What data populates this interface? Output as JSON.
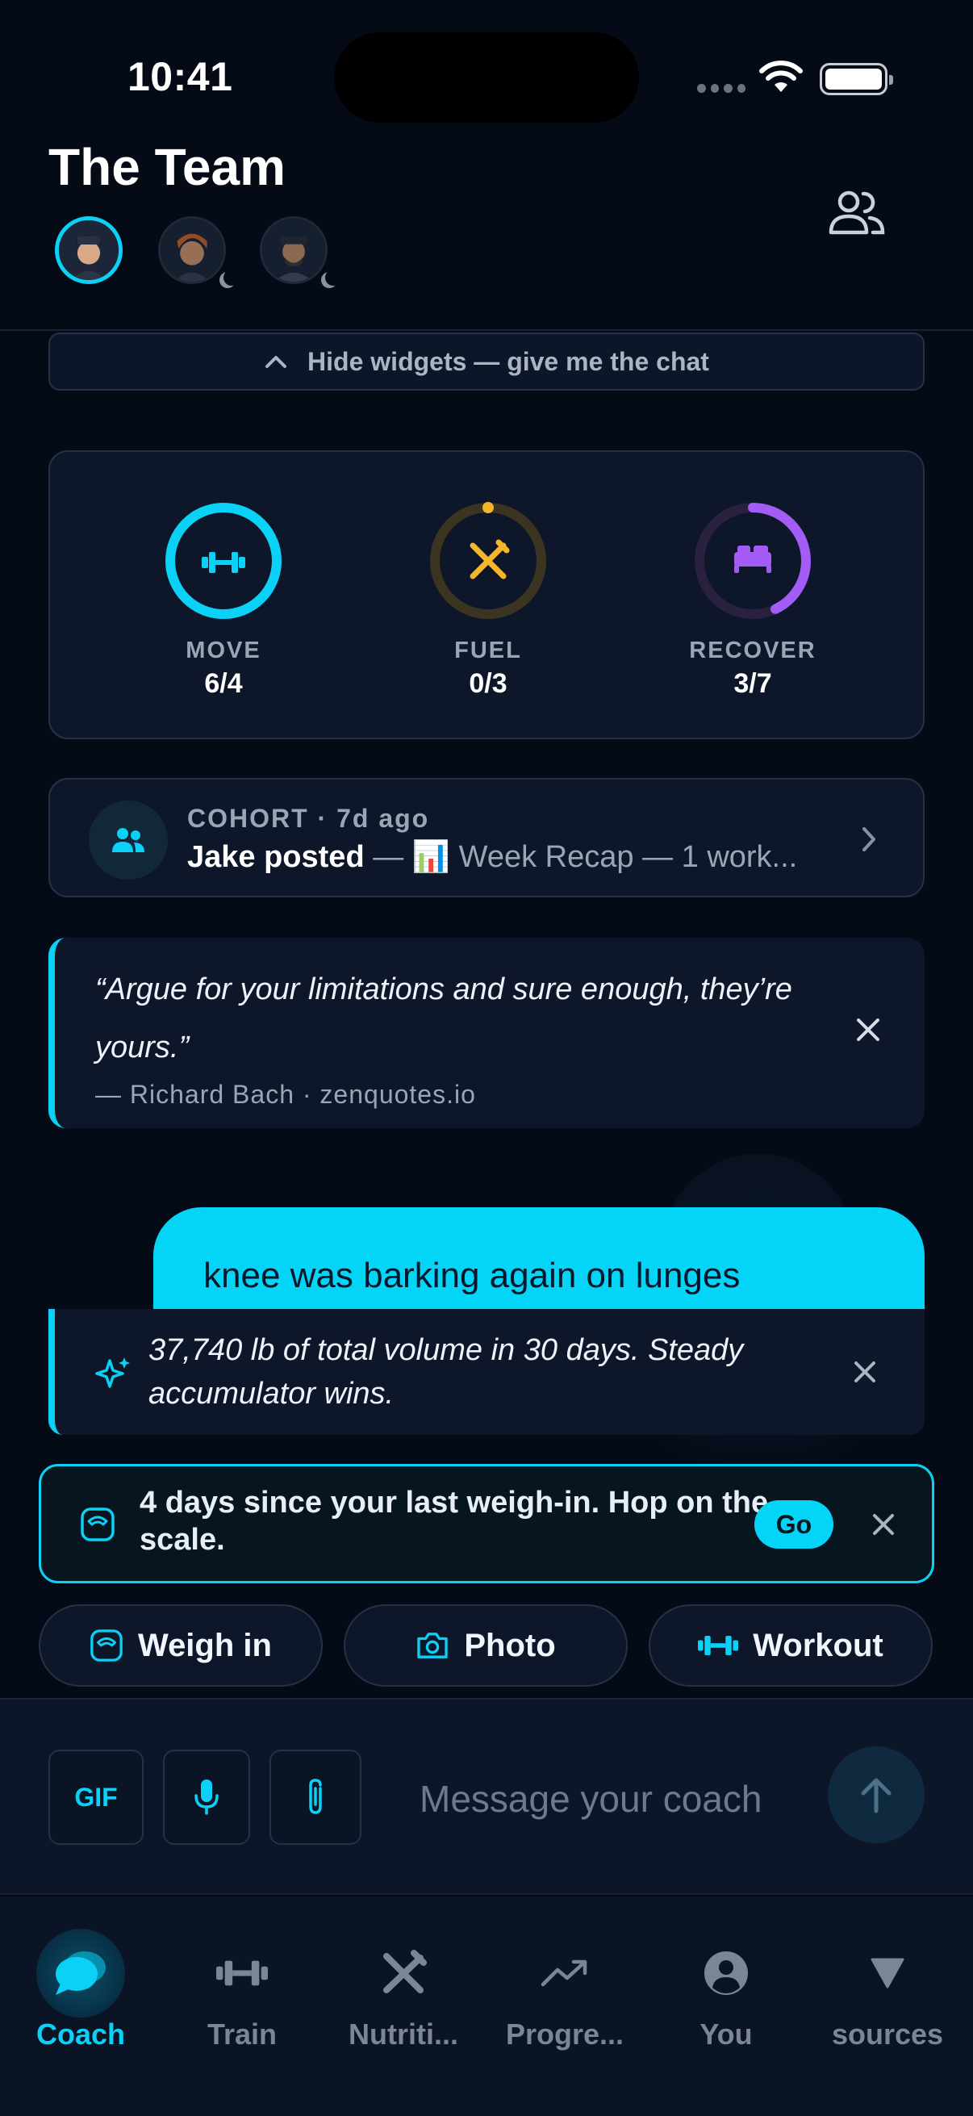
{
  "status_bar": {
    "time": "10:41"
  },
  "header": {
    "title": "The Team"
  },
  "widgets_toggle": {
    "label": "Hide widgets — give me the chat"
  },
  "rings": [
    {
      "label": "MOVE",
      "value": "6/4",
      "progress": 1.0,
      "color": "#0ad1f5",
      "icon": "dumbbell-icon"
    },
    {
      "label": "FUEL",
      "value": "0/3",
      "progress": 0.0,
      "color": "#f5b62a",
      "icon": "utensils-icon"
    },
    {
      "label": "RECOVER",
      "value": "3/7",
      "progress": 0.43,
      "color": "#a35cf5",
      "icon": "bed-icon"
    }
  ],
  "cohort": {
    "meta": "COHORT · 7d ago",
    "author": "Jake posted",
    "separator": " — ",
    "emoji": "📊",
    "preview": " Week Recap — 1 work..."
  },
  "quote": {
    "text": "“Argue for your limitations and sure enough, they’re yours.”",
    "attribution": "— Richard Bach  ·  zenquotes.io"
  },
  "chat": {
    "user_message": "knee was barking again on lunges",
    "insight": "37,740 lb of total volume in 30 days. Steady accumulator wins."
  },
  "nudge": {
    "text": "4 days since your last weigh-in. Hop on the scale.",
    "action": "Go"
  },
  "quick_actions": [
    {
      "label": "Weigh in",
      "icon": "scale-icon"
    },
    {
      "label": "Photo",
      "icon": "camera-icon"
    },
    {
      "label": "Workout",
      "icon": "dumbbell-icon"
    }
  ],
  "composer": {
    "gif_label": "GIF",
    "placeholder": "Message your coach"
  },
  "tabs": [
    {
      "label": "Coach",
      "active": true
    },
    {
      "label": "Train"
    },
    {
      "label": "Nutriti..."
    },
    {
      "label": "Progre..."
    },
    {
      "label": "You"
    },
    {
      "label": "sources"
    }
  ],
  "colors": {
    "accent": "#0ad1f5",
    "fuel": "#f5b62a",
    "recover": "#a35cf5",
    "background": "#050b16"
  }
}
